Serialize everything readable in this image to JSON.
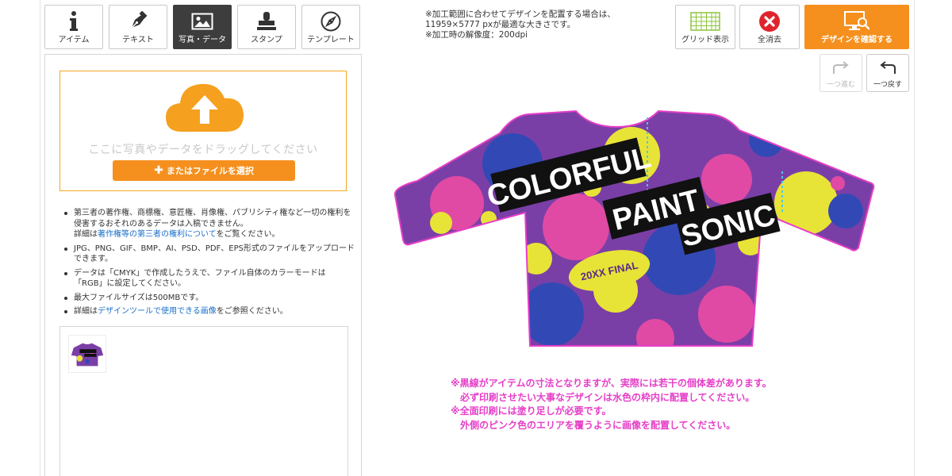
{
  "tools": {
    "item_label": "アイテム",
    "text_label": "テキスト",
    "photo_label": "写真・データ",
    "stamp_label": "スタンプ",
    "template_label": "テンプレート"
  },
  "header_note": {
    "line1": "※加工範囲に合わせてデザインを配置する場合は、",
    "line2": "11959×5777 pxが最適な大きさです。",
    "line3": "※加工時の解像度：200dpi"
  },
  "actions": {
    "grid_label": "グリッド表示",
    "clear_label": "全消去",
    "confirm_label": "デザインを確認する",
    "redo_label": "一つ進む",
    "undo_label": "一つ戻す"
  },
  "upload": {
    "drop_text": "ここに写真やデータをドラッグしてください",
    "file_button": "またはファイルを選択"
  },
  "notes": {
    "n1_text": "第三者の著作権、商標権、意匠権、肖像権、パブリシティ権など一切の権利を侵害するおそれのあるデータは入稿できません。",
    "n1_detail_prefix": "詳細は",
    "n1_link": "著作権等の第三者の権利について",
    "n1_detail_suffix": "をご覧ください。",
    "n2": "JPG、PNG、GIF、BMP、AI、PSD、PDF、EPS形式のファイルをアップロードできます。",
    "n3": "データは「CMYK」で作成したうえで、ファイル自体のカラーモードは「RGB」に設定してください。",
    "n4": "最大ファイルサイズは500MBです。",
    "n5_prefix": "詳細は",
    "n5_link": "デザインツールで使用できる画像",
    "n5_suffix": "をご参照ください。"
  },
  "design": {
    "line1": "COLORFUL",
    "line2": "PAINT",
    "line3": "SONIC",
    "badge": "20XX FINAL"
  },
  "bottom_notes": {
    "line1": "※黒線がアイテムの寸法となりますが、実際には若干の個体差があります。",
    "line2": "必ず印刷させたい大事なデザインは水色の枠内に配置してください。",
    "line3": "※全面印刷には塗り足しが必要です。",
    "line4": "外側のピンク色のエリアを覆うように画像を配置してください。"
  },
  "colors": {
    "accent_orange": "#f5901e",
    "clear_red": "#e0242b",
    "note_pink": "#e63ec8",
    "link_blue": "#1a6fc9"
  }
}
